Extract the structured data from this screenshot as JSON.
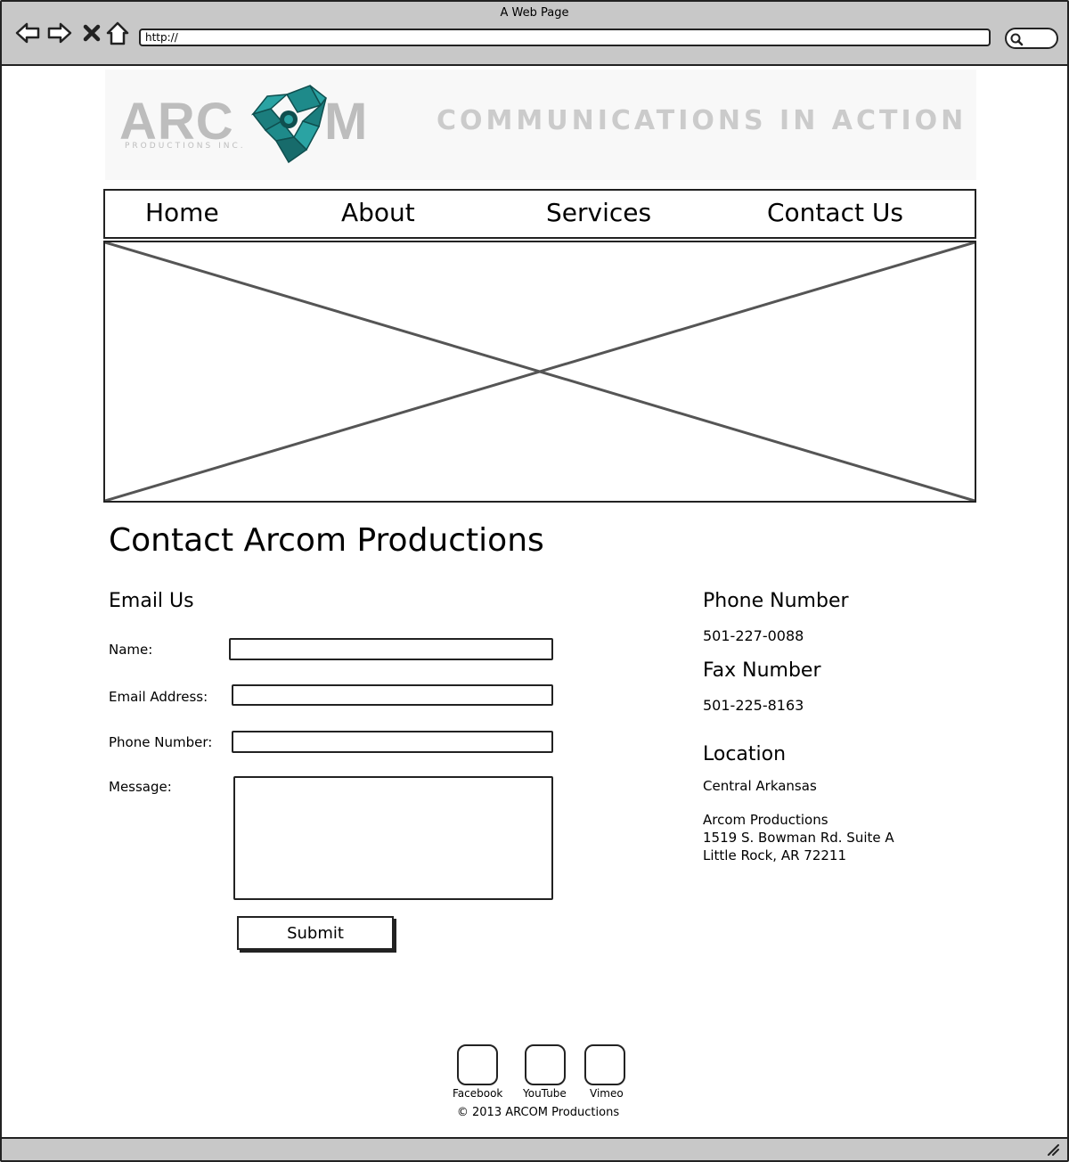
{
  "browser": {
    "window_title": "A Web Page",
    "url": "http://"
  },
  "header": {
    "logo_text": "ARC",
    "logo_text_end": "M",
    "logo_subtext": "PRODUCTIONS INC.",
    "tagline": "COMMUNICATIONS IN ACTION",
    "logo_accent_color": "#1e8a8a"
  },
  "nav": {
    "items": [
      "Home",
      "About",
      "Services",
      "Contact Us"
    ]
  },
  "content": {
    "page_title": "Contact Arcom Productions",
    "email_section": {
      "title": "Email Us",
      "name_label": "Name:",
      "email_label": "Email Address:",
      "phone_label": "Phone Number:",
      "message_label": "Message:",
      "submit_label": "Submit"
    },
    "contact_info": {
      "phone_title": "Phone Number",
      "phone": "501-227-0088",
      "fax_title": "Fax Number",
      "fax": "501-225-8163",
      "location_title": "Location",
      "region": "Central Arkansas",
      "address_lines": [
        "Arcom Productions",
        "1519 S. Bowman Rd. Suite A",
        "Little Rock, AR 72211"
      ]
    }
  },
  "footer": {
    "social": [
      "Facebook",
      "YouTube",
      "Vimeo"
    ],
    "copyright": "© 2013 ARCOM Productions"
  }
}
